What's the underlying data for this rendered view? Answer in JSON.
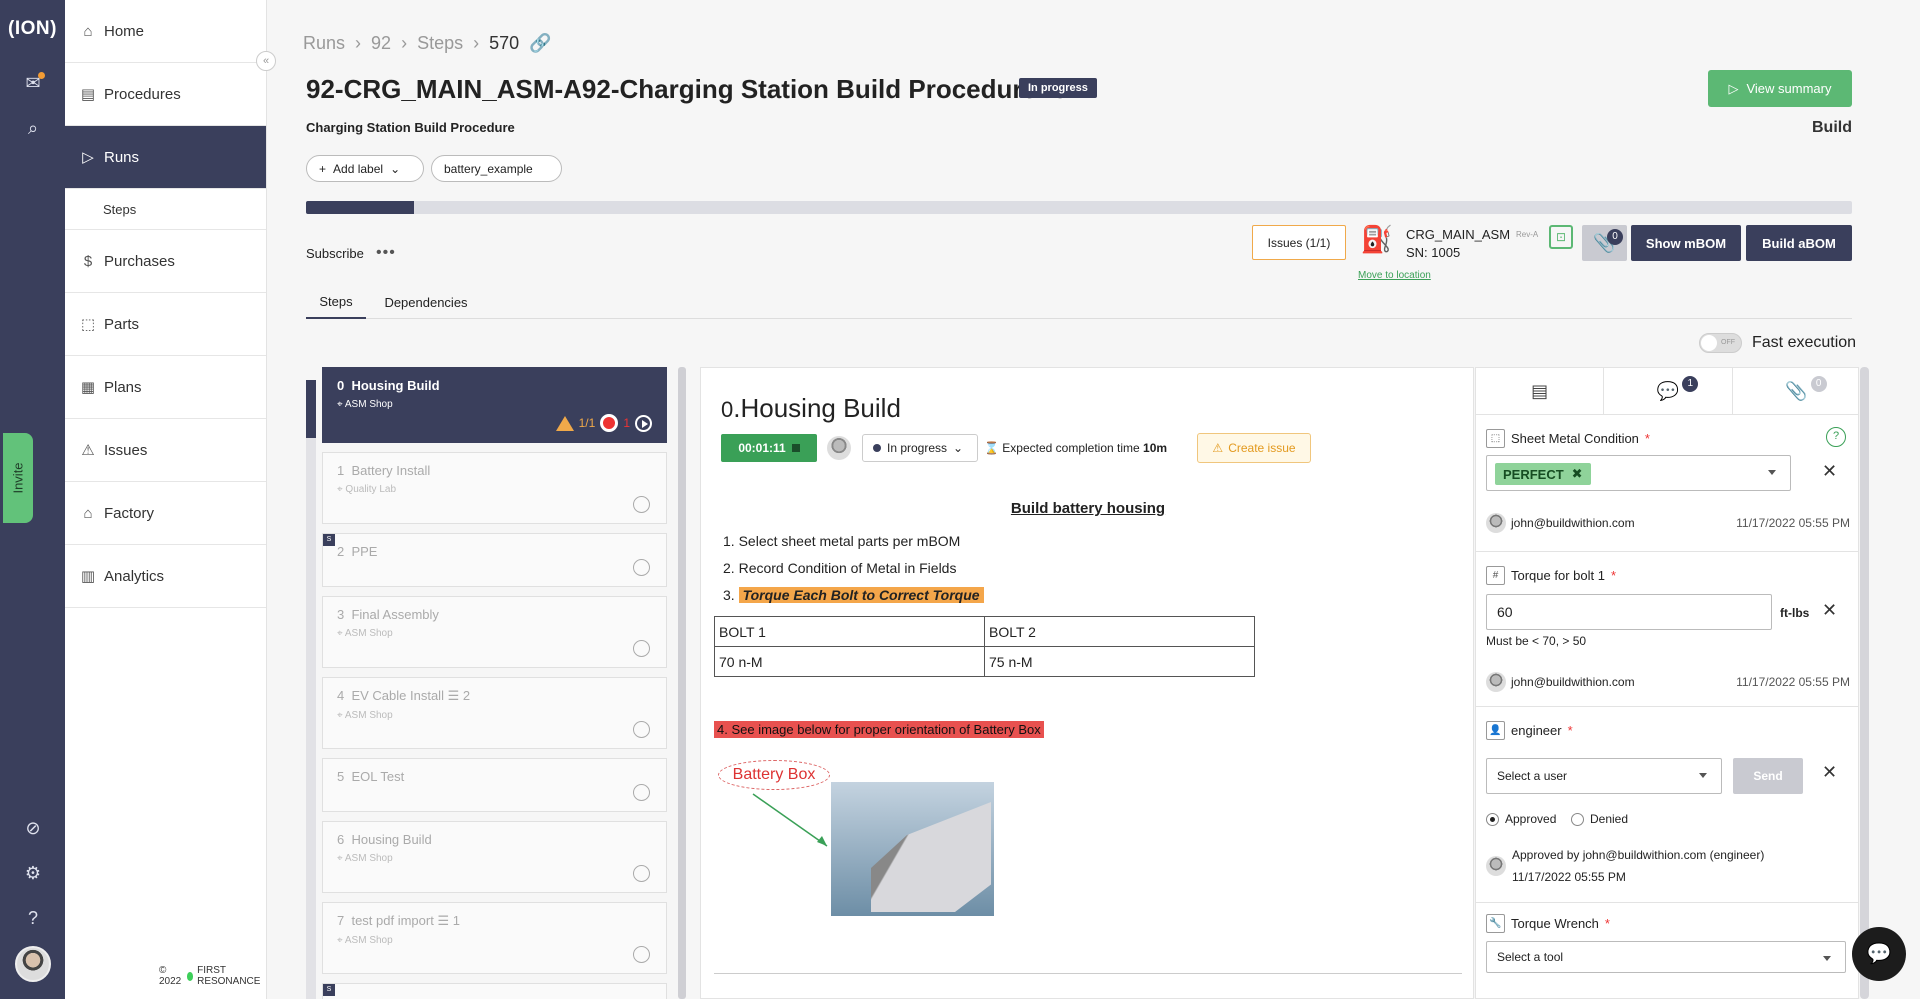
{
  "rail": {
    "logo": "(ION)"
  },
  "invite_label": "Invite",
  "sidebar": {
    "items": [
      {
        "label": "Home",
        "icon": "home-icon"
      },
      {
        "label": "Procedures",
        "icon": "document-icon"
      },
      {
        "label": "Runs",
        "icon": "play-circle-icon"
      },
      {
        "label": "Steps",
        "icon": ""
      },
      {
        "label": "Purchases",
        "icon": "dollar-icon"
      },
      {
        "label": "Parts",
        "icon": "chip-icon"
      },
      {
        "label": "Plans",
        "icon": "calendar-icon"
      },
      {
        "label": "Issues",
        "icon": "warning-icon"
      },
      {
        "label": "Factory",
        "icon": "factory-icon"
      },
      {
        "label": "Analytics",
        "icon": "bar-chart-icon"
      }
    ],
    "footer": "© 2022",
    "footer_brand": "FIRST RESONANCE"
  },
  "breadcrumb": {
    "runs": "Runs",
    "run_id": "92",
    "steps": "Steps",
    "step_id": "570"
  },
  "header": {
    "title": "92-CRG_MAIN_ASM-A92-Charging Station Build Procedure -8",
    "status_badge": "In progress",
    "subtitle": "Charging Station Build Procedure",
    "view_summary": "View summary",
    "build_label": "Build",
    "add_label": "Add label",
    "label_tag": "battery_example",
    "progress": 0.07,
    "subscribe": "Subscribe",
    "more": "•••"
  },
  "unit": {
    "issues_btn": "Issues (1/1)",
    "part": "CRG_MAIN_ASM",
    "rev": "Rev-A",
    "serial": "SN: 1005",
    "move_link": "Move to location",
    "attach_count": "0",
    "show_mbom": "Show mBOM",
    "build_abom": "Build aBOM"
  },
  "tabs": {
    "steps": "Steps",
    "dependencies": "Dependencies"
  },
  "fast_execution": {
    "label": "Fast execution",
    "state": "OFF"
  },
  "steps": [
    {
      "num": "0",
      "name": "Housing Build",
      "loc": "ASM Shop",
      "warn": "1/1",
      "err": "1"
    },
    {
      "num": "1",
      "name": "Battery Install",
      "loc": "Quality Lab"
    },
    {
      "num": "2",
      "name": "PPE",
      "loc": "",
      "badge": "S"
    },
    {
      "num": "3",
      "name": "Final Assembly",
      "loc": "ASM Shop"
    },
    {
      "num": "4",
      "name": "EV Cable Install",
      "loc": "ASM Shop",
      "sub": "2"
    },
    {
      "num": "5",
      "name": "EOL Test",
      "loc": ""
    },
    {
      "num": "6",
      "name": "Housing Build",
      "loc": "ASM Shop"
    },
    {
      "num": "7",
      "name": "test pdf import",
      "loc": "ASM Shop",
      "sub": "1"
    },
    {
      "num": "",
      "name": "",
      "loc": "",
      "badge": "S"
    }
  ],
  "step": {
    "num": "0",
    "title": ".Housing Build",
    "timer": "00:01:11",
    "status": "In progress",
    "expected_prefix": "Expected completion time",
    "expected_value": "10m",
    "create_issue": "Create issue",
    "instr_heading": "Build battery housing",
    "instr": [
      "Select sheet metal parts per mBOM",
      "Record Condition of Metal in Fields",
      "Torque Each Bolt to Correct Torque"
    ],
    "table": [
      [
        "BOLT 1",
        "BOLT 2"
      ],
      [
        "70 n-M",
        "75 n-M"
      ]
    ],
    "step4": "4.  See image below for proper orientation of Battery Box",
    "callout": "Battery Box"
  },
  "fields": {
    "tab_comments_count": "1",
    "tab_attach_count": "0",
    "sheet": {
      "label": "Sheet Metal Condition",
      "value": "PERFECT",
      "user": "john@buildwithion.com",
      "time": "11/17/2022 05:55 PM"
    },
    "torque": {
      "label": "Torque for bolt 1",
      "value": "60",
      "unit": "ft-lbs",
      "hint": "Must be < 70, > 50",
      "user": "john@buildwithion.com",
      "time": "11/17/2022 05:55 PM"
    },
    "engineer": {
      "label": "engineer",
      "placeholder": "Select a user",
      "send": "Send",
      "approved": "Approved",
      "denied": "Denied",
      "approved_by": "Approved by john@buildwithion.com (engineer)",
      "approved_time": "11/17/2022 05:55 PM"
    },
    "wrench": {
      "label": "Torque Wrench",
      "placeholder": "Select a tool"
    }
  },
  "colors": {
    "navy": "#3a3f5c",
    "green": "#5cb874",
    "orange": "#f0a94a",
    "red": "#e8514f"
  }
}
